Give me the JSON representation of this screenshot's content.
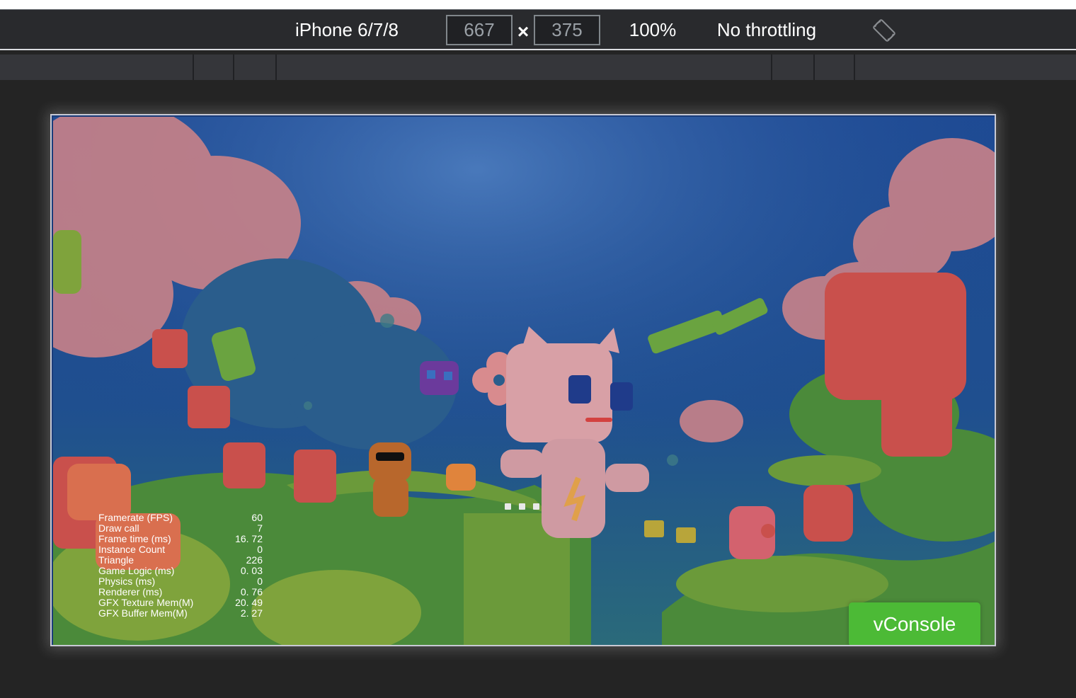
{
  "toolbar": {
    "device_label": "iPhone 6/7/8",
    "width_value": "667",
    "height_value": "375",
    "dimension_separator": "×",
    "zoom_label": "100%",
    "throttle_label": "No throttling",
    "rotate_icon": "rotate-icon"
  },
  "game": {
    "scene_icon": "game-scene-illustration",
    "stats": [
      {
        "label": "Framerate (FPS)",
        "value": "60"
      },
      {
        "label": "Draw call",
        "value": "7"
      },
      {
        "label": "Frame time (ms)",
        "value": "16. 72"
      },
      {
        "label": "Instance Count",
        "value": "0"
      },
      {
        "label": "Triangle",
        "value": "226"
      },
      {
        "label": "Game Logic (ms)",
        "value": "0. 03"
      },
      {
        "label": "Physics (ms)",
        "value": "0"
      },
      {
        "label": "Renderer (ms)",
        "value": "0. 76"
      },
      {
        "label": "GFX Texture Mem(M)",
        "value": "20. 49"
      },
      {
        "label": "GFX Buffer Mem(M)",
        "value": "2. 27"
      }
    ],
    "vconsole_label": "vConsole"
  },
  "colors": {
    "vconsole_green": "#4cba36",
    "toolbar_bg": "#292a2d",
    "media_bar_bg": "#35363a"
  }
}
